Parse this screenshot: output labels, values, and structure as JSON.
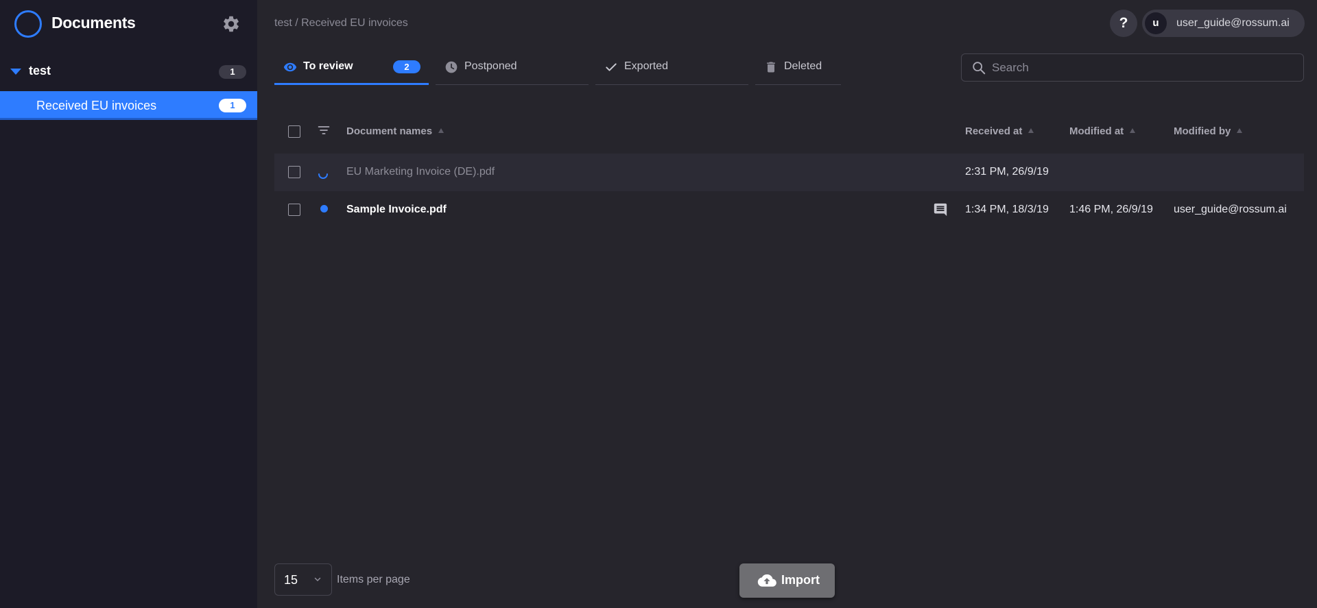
{
  "sidebar": {
    "app_title": "Documents",
    "group": {
      "label": "test",
      "count": "1"
    },
    "items": [
      {
        "label": "Received EU invoices",
        "count": "1"
      }
    ]
  },
  "header": {
    "breadcrumb": "test / Received EU invoices",
    "help_label": "?",
    "user": {
      "avatar_initial": "u",
      "email": "user_guide@rossum.ai"
    }
  },
  "tabs": [
    {
      "label": "To review",
      "badge": "2",
      "icon": "eye-icon"
    },
    {
      "label": "Postponed",
      "icon": "clock-icon"
    },
    {
      "label": "Exported",
      "icon": "check-icon"
    },
    {
      "label": "Deleted",
      "icon": "trash-icon"
    }
  ],
  "search": {
    "placeholder": "Search",
    "value": ""
  },
  "table": {
    "columns": [
      "Document names",
      "Received at",
      "Modified at",
      "Modified by"
    ],
    "rows": [
      {
        "name": "EU Marketing Invoice (DE).pdf",
        "received_at": "2:31 PM, 26/9/19",
        "modified_at": "",
        "modified_by": "",
        "status": "processing"
      },
      {
        "name": "Sample Invoice.pdf",
        "received_at": "1:34 PM, 18/3/19",
        "modified_at": "1:46 PM, 26/9/19",
        "modified_by": "user_guide@rossum.ai",
        "status": "to-review"
      }
    ]
  },
  "footer": {
    "per_page_value": "15",
    "per_page_label": "Items per page",
    "import_label": "Import"
  },
  "colors": {
    "accent": "#2e7cff",
    "sidebar_bg": "#1c1b27",
    "main_bg": "#26252c"
  }
}
